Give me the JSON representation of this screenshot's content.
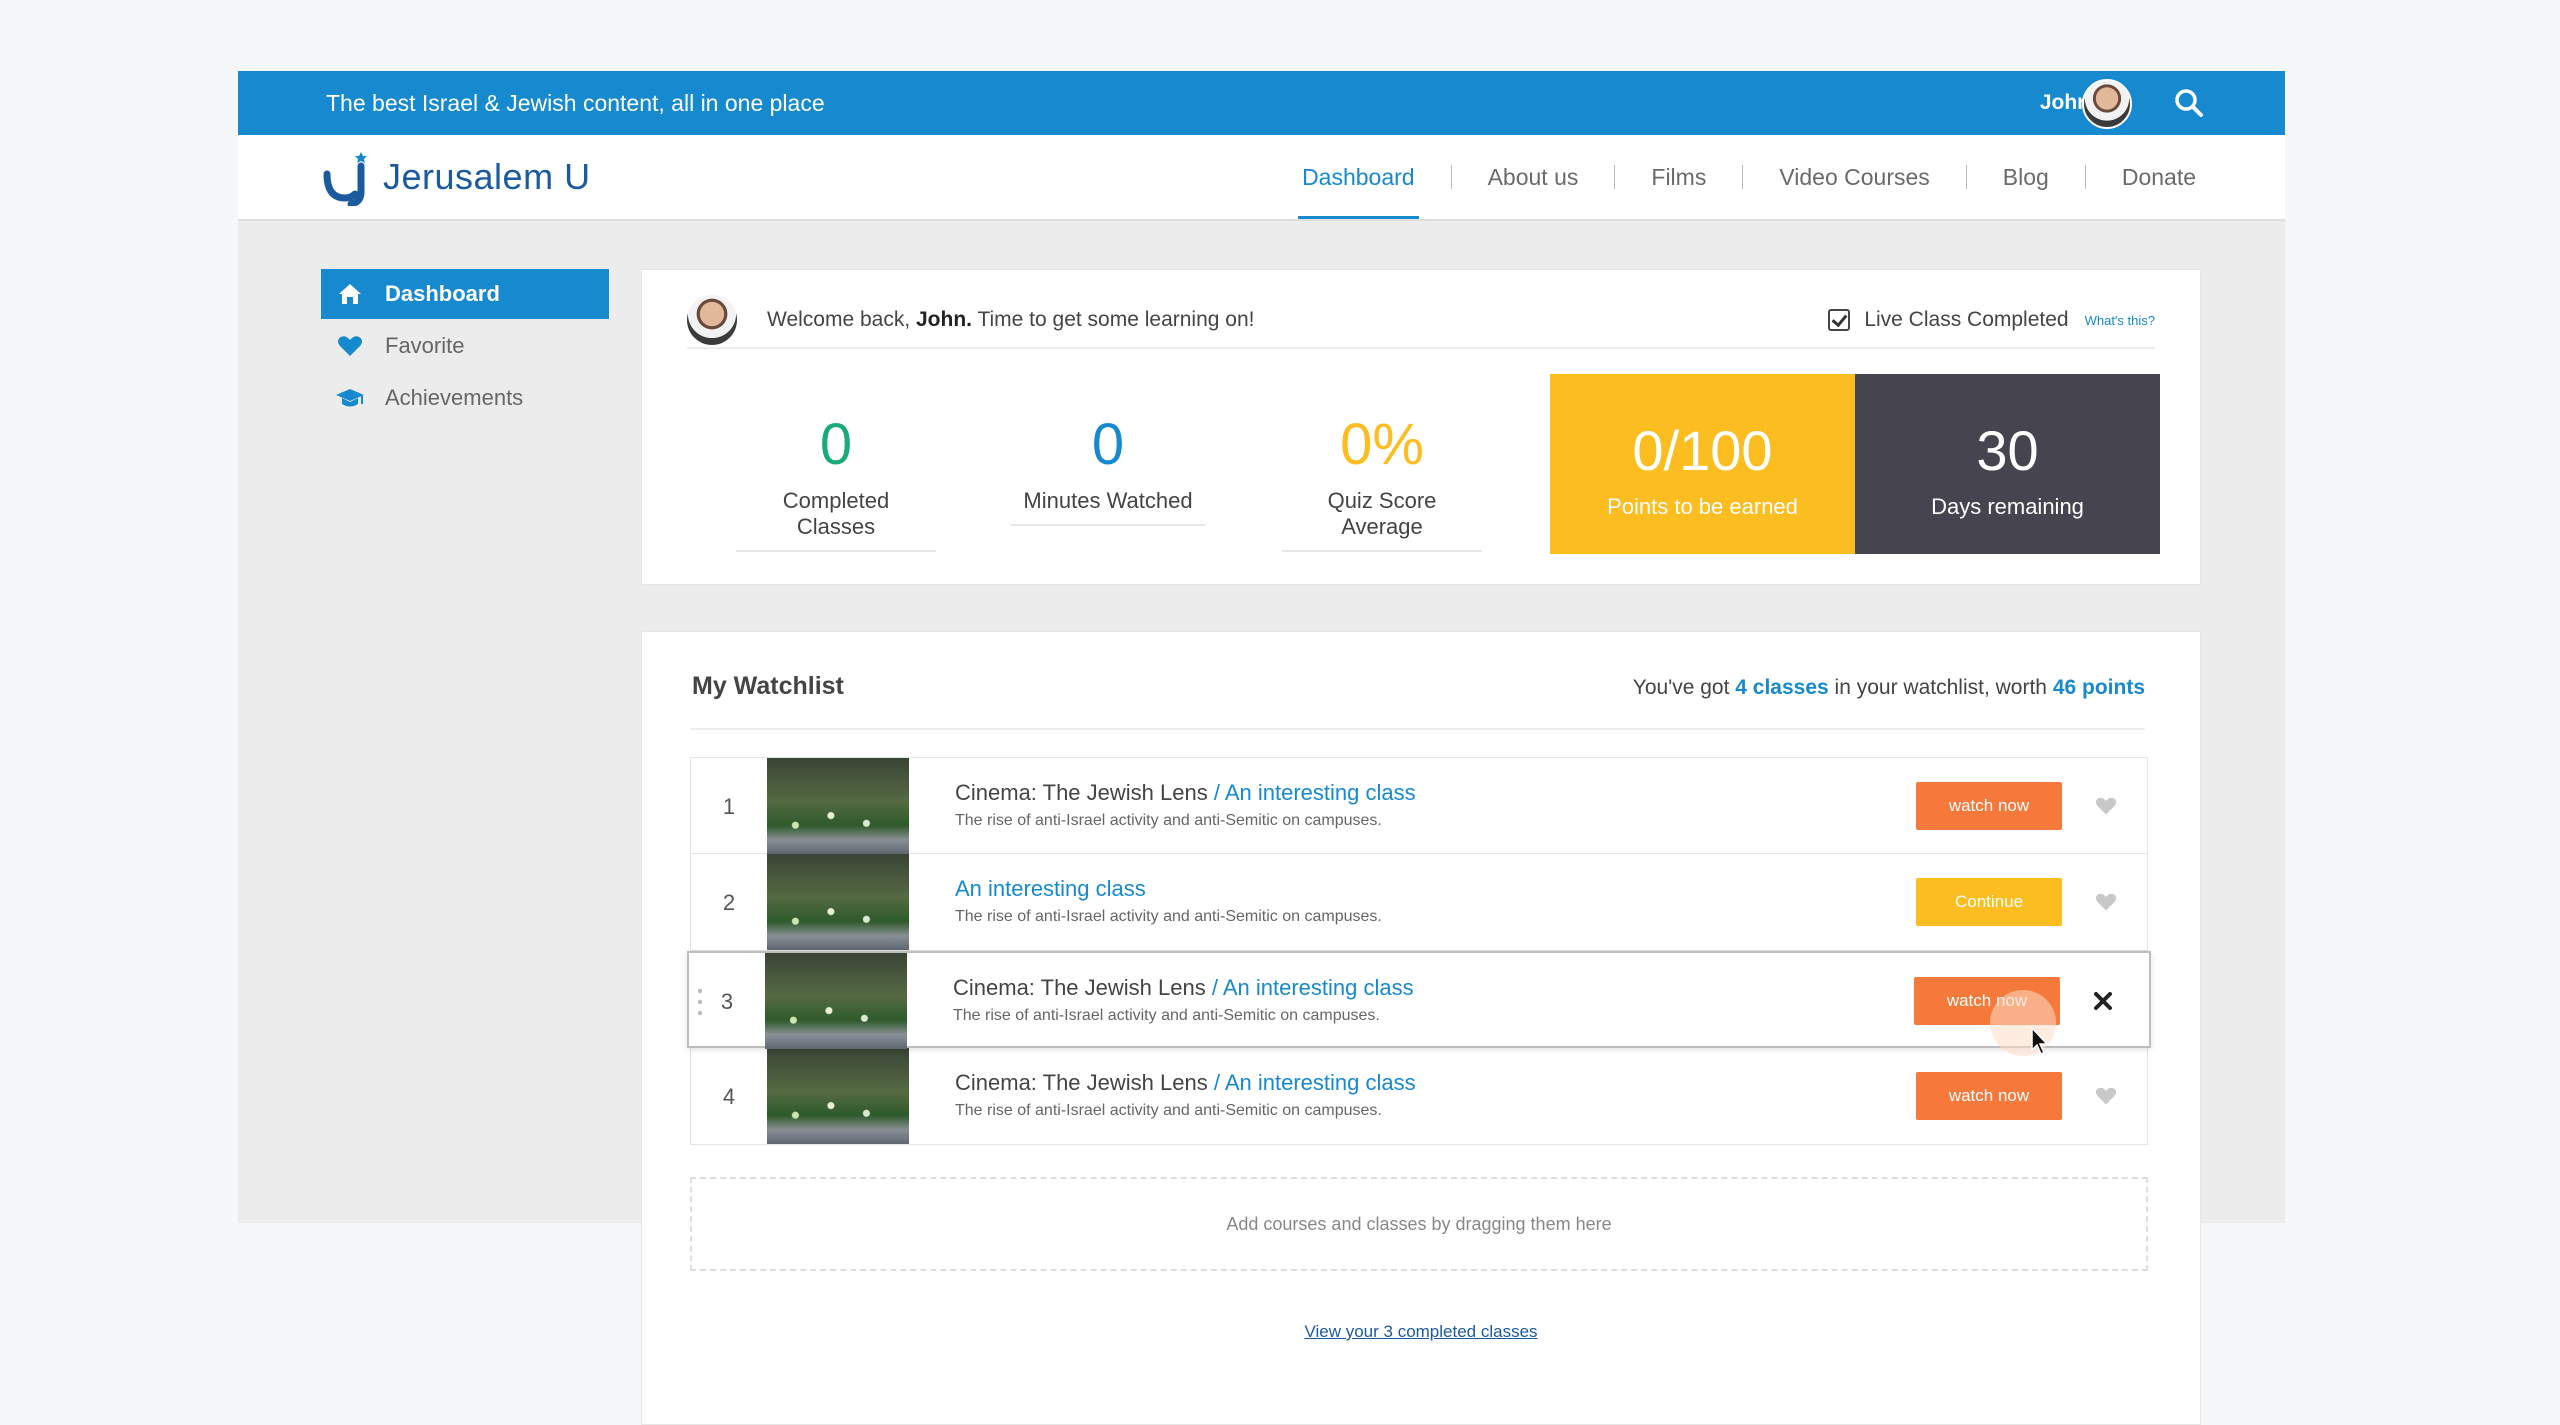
{
  "topbar": {
    "tagline": "The best Israel & Jewish content, all in one place",
    "user_name": "John"
  },
  "brand": {
    "name": "Jerusalem U"
  },
  "nav": {
    "links": [
      "Dashboard",
      "About us",
      "Films",
      "Video Courses",
      "Blog",
      "Donate"
    ],
    "active": "Dashboard"
  },
  "sidebar": {
    "items": [
      {
        "label": "Dashboard",
        "icon": "home-icon",
        "active": true
      },
      {
        "label": "Favorite",
        "icon": "heart-icon",
        "active": false
      },
      {
        "label": "Achievements",
        "icon": "graduation-cap-icon",
        "active": false
      }
    ]
  },
  "welcome": {
    "prefix": "Welcome back, ",
    "name": "John.",
    "suffix": " Time to get some learning on!",
    "live_class_label": "Live Class Completed",
    "live_class_checked": true,
    "whats_this": "What's this?"
  },
  "stats": {
    "completed": {
      "value": "0",
      "label": "Completed Classes",
      "color": "#1aab7a"
    },
    "minutes": {
      "value": "0",
      "label": "Minutes Watched",
      "color": "#1689cf"
    },
    "quiz": {
      "value": "0%",
      "label": "Quiz Score Average",
      "color": "#fbbd1f"
    },
    "points": {
      "value": "0/100",
      "label": "Points to be earned",
      "color": "#fbbd1f"
    },
    "days": {
      "value": "30",
      "label": "Days remaining",
      "color": "#46454f"
    }
  },
  "watchlist": {
    "title": "My Watchlist",
    "summary_prefix": "You've got ",
    "summary_classes": "4 classes",
    "summary_middle": " in your watchlist, worth ",
    "summary_points": "46 points",
    "rows": [
      {
        "num": "1",
        "title": "Cinema: The Jewish Lens",
        "subtitle": " / An interesting class",
        "desc": "The rise of anti-Israel activity and anti-Semitic on campuses.",
        "button": "watch now",
        "button_color": "#f4793a"
      },
      {
        "num": "2",
        "title": "",
        "subtitle": "An interesting class",
        "desc": "The rise of anti-Israel activity and anti-Semitic on campuses.",
        "button": "Continue",
        "button_color": "#fbbd1f"
      },
      {
        "num": "3",
        "title": "Cinema: The Jewish Lens",
        "subtitle": " / An interesting class",
        "desc": "The rise of anti-Israel activity and anti-Semitic on campuses.",
        "button": "watch now",
        "button_color": "#f4793a"
      },
      {
        "num": "4",
        "title": "Cinema: The Jewish Lens",
        "subtitle": " / An interesting class",
        "desc": "The rise of anti-Israel activity and anti-Semitic on campuses.",
        "button": "watch now",
        "button_color": "#f4793a"
      }
    ],
    "dropzone": "Add courses and classes by dragging them here",
    "completed_link": "View your 3 completed classes"
  }
}
